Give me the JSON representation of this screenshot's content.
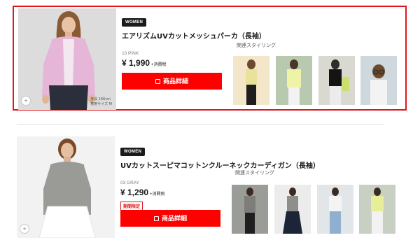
{
  "products": [
    {
      "tag": "WOMEN",
      "title": "エアリズムUVカットメッシュパーカ（長袖）",
      "color": "10 PINK",
      "price": "¥ 1,990",
      "tax": "+消費税",
      "limited": "",
      "detail_label": "商品詳細",
      "related_label": "関連スタイリング",
      "model_caption": [
        "身長 166cm",
        "着用サイズ M"
      ],
      "zoom_label": "+",
      "swatch": "#e5b6d8"
    },
    {
      "tag": "WOMEN",
      "title": "UVカットスーピマコットンクルーネックカーディガン（長袖）",
      "color": "03 GRAY",
      "price": "¥ 1,290",
      "tax": "+消費税",
      "limited": "期間限定",
      "detail_label": "商品詳細",
      "related_label": "関連スタイリング",
      "zoom_label": "+",
      "swatch": "#9a9a96"
    }
  ],
  "colors": {
    "accent": "#ff0000",
    "selection_border": "#e0161e"
  }
}
